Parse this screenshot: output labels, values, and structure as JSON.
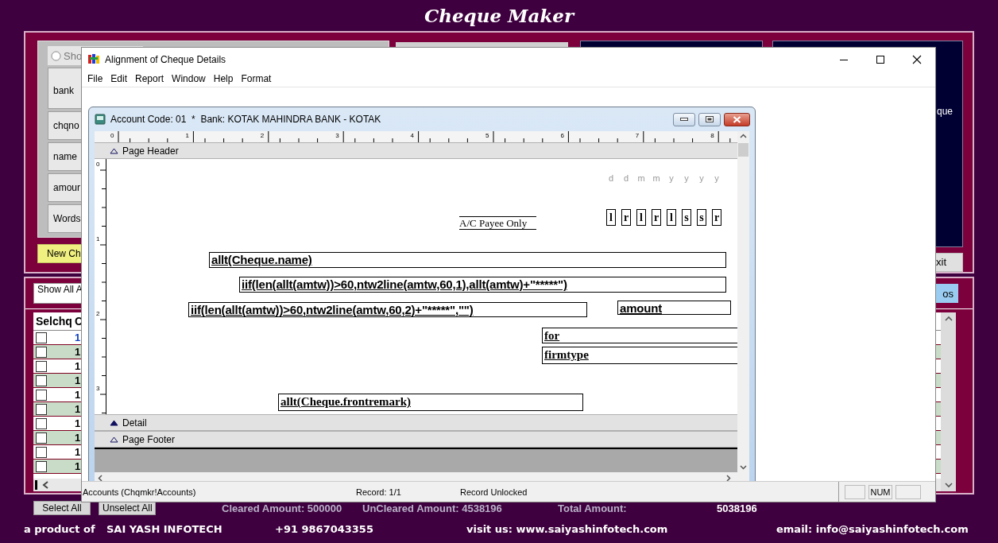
{
  "app": {
    "title": "Cheque Maker",
    "top_panel": {
      "radio": {
        "label": "Sho",
        "checked": false
      },
      "buttons": [
        "bank",
        "chqno",
        "name",
        "amour",
        "Words"
      ],
      "new_button": "New Ch",
      "side_text": "que",
      "exit_button": "xit"
    },
    "list_panel": {
      "filter": "Show All A",
      "button": "os",
      "columns": [
        "Selchq",
        "C"
      ],
      "rows": [
        {
          "checked": false,
          "text": "1",
          "selected": true
        },
        {
          "checked": false,
          "text": "1",
          "selected": false
        },
        {
          "checked": false,
          "text": "1",
          "selected": false
        },
        {
          "checked": false,
          "text": "1",
          "selected": false
        },
        {
          "checked": false,
          "text": "1",
          "selected": false
        },
        {
          "checked": false,
          "text": "1",
          "selected": false
        },
        {
          "checked": false,
          "text": "1",
          "selected": false
        },
        {
          "checked": false,
          "text": "1",
          "selected": false
        },
        {
          "checked": false,
          "text": "1",
          "selected": false
        },
        {
          "checked": false,
          "text": "1",
          "selected": false
        }
      ]
    },
    "totals": {
      "select_all": "Select All",
      "unselect_all": "Unselect All",
      "cleared": "Cleared Amount: 500000",
      "uncleared": "UnCleared Amount: 4538196",
      "total_label": "Total Amount:",
      "total_value": "5038196"
    },
    "footer": [
      "a product of",
      "SAI YASH INFOTECH",
      "+91 9867043355",
      "visit us: www.saiyashinfotech.com",
      "email: info@saiyashinfotech.com"
    ]
  },
  "dialog": {
    "title": "Alignment of Cheque Details",
    "menu": [
      "File",
      "Edit",
      "Report",
      "Window",
      "Help",
      "Format"
    ],
    "report_window": {
      "title": "Account Code: 01  *  Bank: KOTAK MAHINDRA BANK - KOTAK",
      "ruler": {
        "horizontal": [
          "0",
          "1",
          "2",
          "3",
          "4",
          "5",
          "6",
          "7",
          "8"
        ],
        "vertical": [
          "0",
          "1",
          "2",
          "3"
        ]
      },
      "bands": [
        {
          "label": "Page Header",
          "selected": false
        },
        {
          "label": "Detail",
          "selected": true
        },
        {
          "label": "Page Footer",
          "selected": false
        }
      ],
      "date_labels": [
        "d",
        "d",
        "m",
        "m",
        "y",
        "y",
        "y",
        "y"
      ],
      "date_boxes": [
        "l",
        "r",
        "l",
        "r",
        "l",
        "s",
        "s",
        "r"
      ],
      "fields": [
        {
          "kind": "label",
          "text": "A/C Payee Only"
        },
        {
          "kind": "expression",
          "text": "allt(Cheque.name)"
        },
        {
          "kind": "expression",
          "text": "iif(len(allt(amtw))>60,ntw2line(amtw,60,1),allt(amtw)+\"*****\")"
        },
        {
          "kind": "expression",
          "text": "iif(len(allt(amtw))>60,ntw2line(amtw,60,2)+\"*****\",\"\")"
        },
        {
          "kind": "expression",
          "text": "amount"
        },
        {
          "kind": "serif",
          "text": "for"
        },
        {
          "kind": "serif",
          "text": "firmtype"
        },
        {
          "kind": "serif",
          "text": "allt(Cheque.frontremark)"
        }
      ]
    },
    "status_bar": {
      "sections": [
        "Accounts (Chqmkr!Accounts)",
        "Record: 1/1",
        "Record Unlocked"
      ],
      "indicators": [
        "NUM"
      ]
    }
  }
}
